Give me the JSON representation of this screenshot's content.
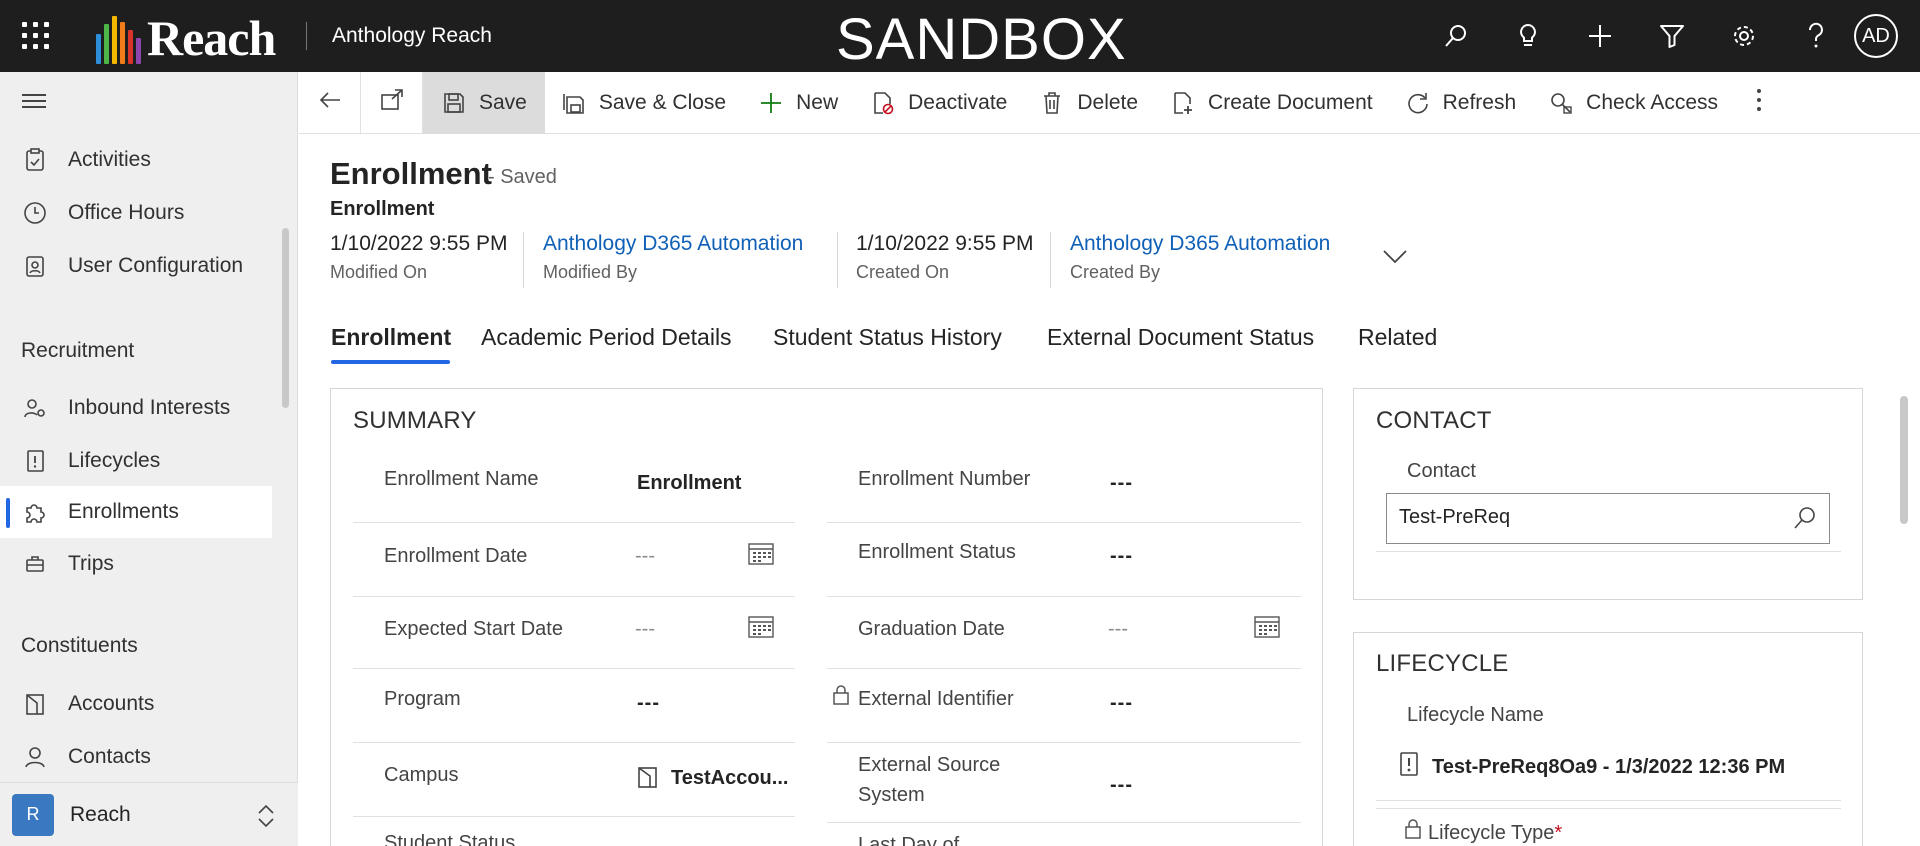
{
  "topbar": {
    "logo_text": "Reach",
    "app_name": "Anthology Reach",
    "environment": "SANDBOX",
    "user_initials": "AD",
    "icons": [
      "search-icon",
      "lightbulb-icon",
      "plus-icon",
      "filter-icon",
      "gear-icon",
      "help-icon"
    ]
  },
  "sidebar": {
    "items": [
      {
        "label": "Activities",
        "icon": "clipboard-icon"
      },
      {
        "label": "Office Hours",
        "icon": "clock-icon"
      },
      {
        "label": "User Configuration",
        "icon": "badge-icon"
      }
    ],
    "groups": [
      {
        "title": "Recruitment",
        "items": [
          {
            "label": "Inbound Interests",
            "icon": "people-gear-icon"
          },
          {
            "label": "Lifecycles",
            "icon": "document-alert-icon"
          },
          {
            "label": "Enrollments",
            "icon": "puzzle-icon",
            "selected": true
          },
          {
            "label": "Trips",
            "icon": "briefcase-icon"
          }
        ]
      },
      {
        "title": "Constituents",
        "items": [
          {
            "label": "Accounts",
            "icon": "building-icon"
          },
          {
            "label": "Contacts",
            "icon": "person-icon"
          }
        ]
      }
    ],
    "area": {
      "badge": "R",
      "name": "Reach"
    }
  },
  "commands": {
    "save": "Save",
    "save_close": "Save & Close",
    "new": "New",
    "deactivate": "Deactivate",
    "delete": "Delete",
    "create_document": "Create Document",
    "refresh": "Refresh",
    "check_access": "Check Access"
  },
  "record": {
    "title": "Enrollment",
    "status": "- Saved",
    "entity": "Enrollment",
    "header_fields": [
      {
        "value": "1/10/2022 9:55 PM",
        "label": "Modified On"
      },
      {
        "value": "Anthology D365 Automation",
        "label": "Modified By"
      },
      {
        "value": "1/10/2022 9:55 PM",
        "label": "Created On"
      },
      {
        "value": "Anthology D365 Automation",
        "label": "Created By"
      }
    ]
  },
  "tabs": [
    "Enrollment",
    "Academic Period Details",
    "Student Status History",
    "External Document Status",
    "Related"
  ],
  "summary": {
    "title": "SUMMARY",
    "left": [
      {
        "label": "Enrollment Name",
        "value": "Enrollment"
      },
      {
        "label": "Enrollment Date",
        "value": "---"
      },
      {
        "label": "Expected Start Date",
        "value": "---"
      },
      {
        "label": "Program",
        "value": "---"
      },
      {
        "label": "Campus",
        "value": "TestAccou..."
      },
      {
        "label": "Student Status",
        "value": ""
      }
    ],
    "right": [
      {
        "label": "Enrollment Number",
        "value": "---"
      },
      {
        "label": "Enrollment Status",
        "value": "---"
      },
      {
        "label": "Graduation Date",
        "value": "---"
      },
      {
        "label": "External Identifier",
        "value": "---"
      },
      {
        "label": "External Source System",
        "value": "---"
      },
      {
        "label": "Last Day of",
        "value": ""
      }
    ]
  },
  "contact": {
    "title": "CONTACT",
    "field_label": "Contact",
    "value": "Test-PreReq"
  },
  "lifecycle": {
    "title": "LIFECYCLE",
    "name_label": "Lifecycle Name",
    "name_value": "Test-PreReq8Oa9 - 1/3/2022 12:36 PM",
    "type_label": "Lifecycle Type",
    "required_mark": "*"
  },
  "colors": {
    "accent": "#2266e3",
    "link": "#1160b7",
    "topbar": "#1e1e1e",
    "sidebar": "#efefef"
  }
}
